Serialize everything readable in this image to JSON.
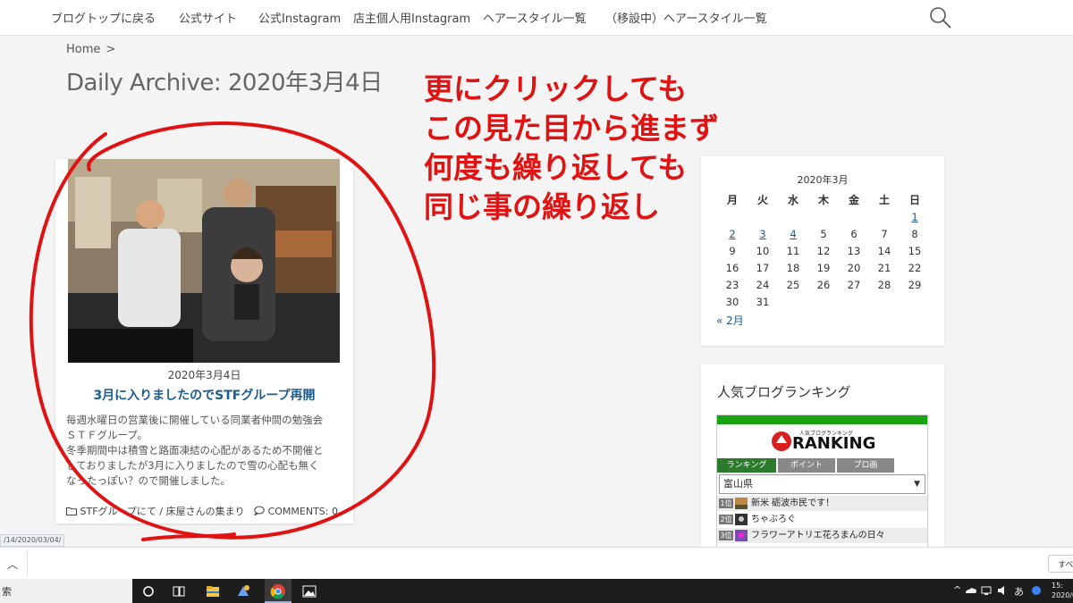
{
  "nav": {
    "items": [
      "ブログトップに戻る",
      "公式サイト",
      "公式Instagram",
      "店主個人用Instagram",
      "ヘアースタイル一覧",
      "（移設中）ヘアースタイル一覧"
    ]
  },
  "breadcrumb": {
    "home": "Home",
    "separator": ">"
  },
  "archive_title": "Daily Archive: 2020年3月4日",
  "post": {
    "date": "2020年3月4日",
    "title": "3月に入りましたのでSTFグループ再開",
    "excerpt": [
      "毎週水曜日の営業後に開催している同業者仲間の勉強会",
      "ＳＴＦグループ。",
      "冬季期間中は積雪と路面凍結の心配があるため不開催と",
      "しておりましたが3月に入りましたので雪の心配も無く",
      "なったっぽい？ので開催しました。"
    ],
    "categories": "STFグループにて / 床屋さんの集まり",
    "comments": "COMMENTS: 0"
  },
  "annotation": {
    "lines": [
      "更にクリックしても",
      "この見た目から進まず",
      "何度も繰り返しても",
      "同じ事の繰り返し"
    ],
    "color": "#e01212"
  },
  "calendar": {
    "caption": "2020年3月",
    "weekdays": [
      "月",
      "火",
      "水",
      "木",
      "金",
      "土",
      "日"
    ],
    "weeks": [
      [
        "",
        "",
        "",
        "",
        "",
        "",
        "1"
      ],
      [
        "2",
        "3",
        "4",
        "5",
        "6",
        "7",
        "8"
      ],
      [
        "9",
        "10",
        "11",
        "12",
        "13",
        "14",
        "15"
      ],
      [
        "16",
        "17",
        "18",
        "19",
        "20",
        "21",
        "22"
      ],
      [
        "23",
        "24",
        "25",
        "26",
        "27",
        "28",
        "29"
      ],
      [
        "30",
        "31",
        "",
        "",
        "",
        "",
        ""
      ]
    ],
    "linked_days": [
      "1",
      "2",
      "3",
      "4"
    ],
    "prev_link": "« 2月"
  },
  "ranking": {
    "title": "人気ブログランキング",
    "logo_text": "RANKING",
    "logo_small": "人気ブログランキング",
    "tabs": [
      "ランキング",
      "ポイント",
      "プロ画"
    ],
    "region": "富山県",
    "entries": [
      {
        "rank": "1位",
        "name": "新米 砺波市民です！"
      },
      {
        "rank": "2位",
        "name": "ちゃぶろぐ"
      },
      {
        "rank": "3位",
        "name": "フラワーアトリエ花ろまんの日々"
      }
    ]
  },
  "browser": {
    "status_url": "/14/2020/03/04/",
    "download_right": "すべ"
  },
  "taskbar": {
    "search_label": "索",
    "tray_ime": "あ",
    "clock_time": "15:",
    "clock_date": "2020/0"
  }
}
